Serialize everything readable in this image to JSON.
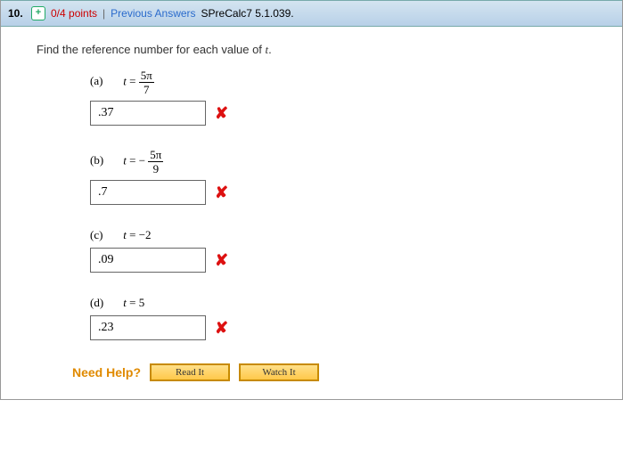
{
  "header": {
    "question_number": "10.",
    "points": "0/4 points",
    "sep": " | ",
    "prev_answers": "Previous Answers",
    "source": "SPreCalc7 5.1.039."
  },
  "prompt_pre": "Find the reference number for each value of ",
  "prompt_var": "t",
  "prompt_post": ".",
  "parts": {
    "a": {
      "label": "(a)",
      "eq_lhs": "t",
      "eq_mid": " = ",
      "num": "5π",
      "den": "7",
      "answer": ".37"
    },
    "b": {
      "label": "(b)",
      "eq_lhs": "t",
      "eq_mid": " = − ",
      "num": "5π",
      "den": "9",
      "answer": ".7"
    },
    "c": {
      "label": "(c)",
      "eq_lhs": "t",
      "eq_mid": " = ",
      "rhs": "−2",
      "answer": ".09"
    },
    "d": {
      "label": "(d)",
      "eq_lhs": "t",
      "eq_mid": " = ",
      "rhs": "5",
      "answer": ".23"
    }
  },
  "help": {
    "label": "Need Help?",
    "read": "Read It",
    "watch": "Watch It"
  }
}
